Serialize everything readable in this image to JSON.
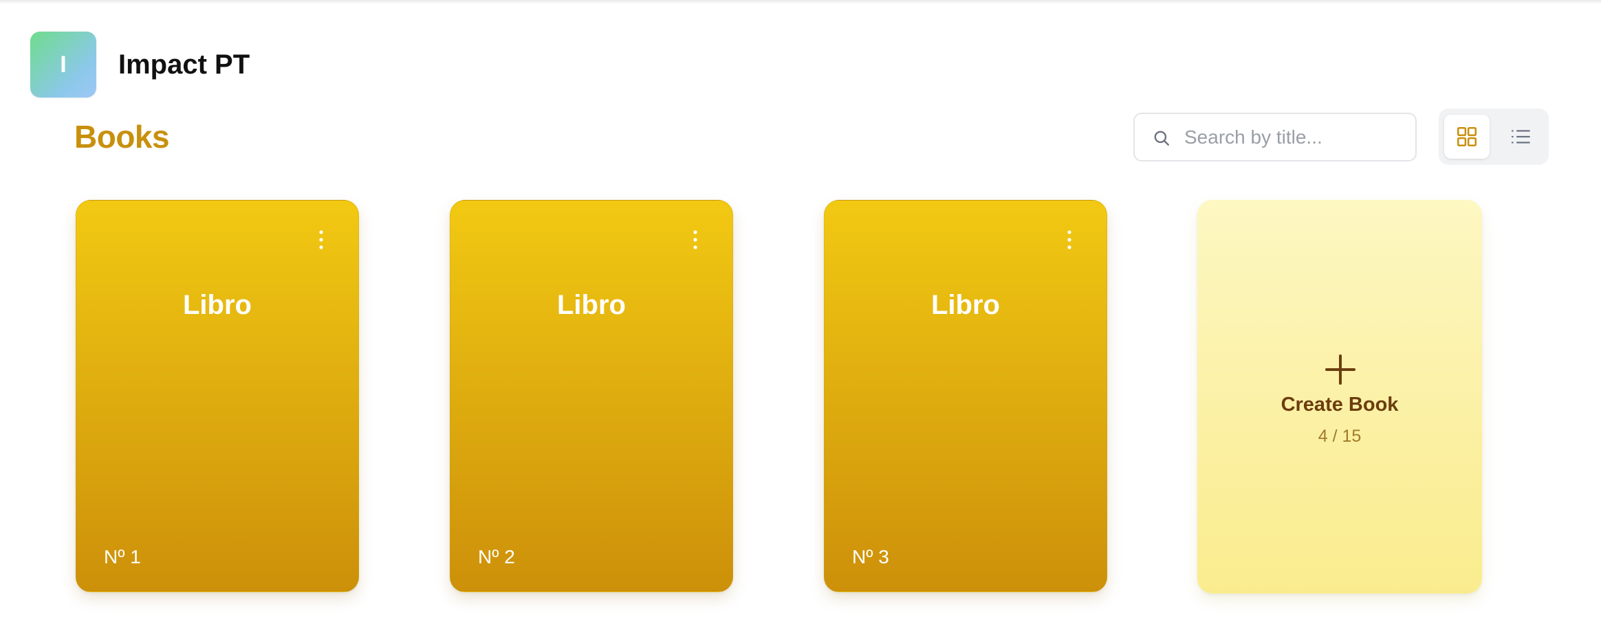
{
  "brand": {
    "avatar_letter": "I",
    "name": "Impact PT"
  },
  "page": {
    "title": "Books"
  },
  "search": {
    "placeholder": "Search by title...",
    "value": ""
  },
  "view_toggle": {
    "active": "grid",
    "options": [
      "grid",
      "list"
    ]
  },
  "books": [
    {
      "title": "Libro",
      "number": "Nº 1"
    },
    {
      "title": "Libro",
      "number": "Nº 2"
    },
    {
      "title": "Libro",
      "number": "Nº 3"
    }
  ],
  "create_card": {
    "label": "Create Book",
    "count": "4 / 15"
  },
  "colors": {
    "accent": "#c8900d",
    "card_top": "#f2c912",
    "card_bottom": "#cd900a",
    "create_bg": "#fbf0a2",
    "create_text": "#6b3d0e"
  },
  "icons": {
    "search": "search-icon",
    "grid_view": "grid-view-icon",
    "list_view": "list-view-icon",
    "card_menu": "more-vertical-icon",
    "create": "plus-icon"
  }
}
